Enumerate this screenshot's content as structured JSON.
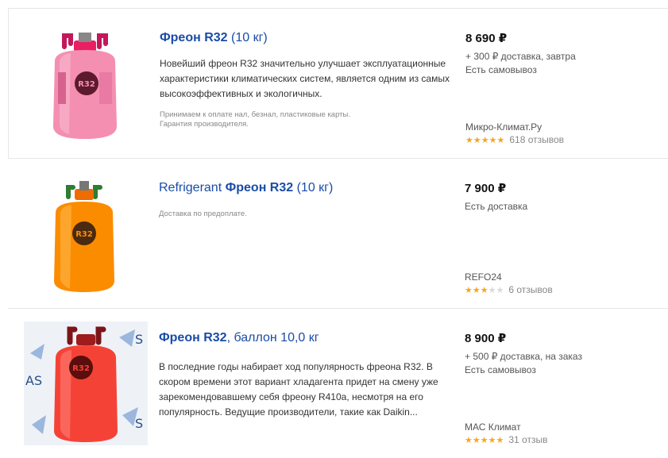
{
  "colors": {
    "link": "#1a4ca8",
    "star": "#f5a623"
  },
  "offers": [
    {
      "title_bold_1": "Фреон R32",
      "title_rest": " (10 кг)",
      "desc": "Новейший фреон R32 значительно улучшает эксплуатационные характеристики климатических систем, является одним из самых высокоэффективных и экологичных.",
      "note_1": "Принимаем к оплате нал, безнал, пластиковые карты.",
      "note_2": "Гарантия производителя.",
      "price": "8 690 ₽",
      "delivery": "+ 300 ₽ доставка, завтра",
      "pickup": "Есть самовывоз",
      "shop": "Микро-Климат.Ру",
      "stars": 5,
      "reviews": "618 отзывов",
      "image_label": "R32",
      "image_color": "pink"
    },
    {
      "title_prefix": "Refrigerant ",
      "title_bold_1": "Фреон R32",
      "title_rest": " (10 кг)",
      "note_1": "Доставка по предоплате.",
      "price": "7 900 ₽",
      "delivery": "Есть доставка",
      "shop": "REFO24",
      "stars": 3,
      "reviews": "6 отзывов",
      "image_label": "R32",
      "image_color": "orange"
    },
    {
      "title_bold_1": "Фреон R32",
      "title_rest": ", баллон 10,0 кг",
      "desc": "В последние годы набирает ход популярность фреона R32. В скором времени этот вариант хладагента придет на смену уже зарекомендовавшему себя фреону R410a, несмотря на его популярность. Ведущие производители, такие как Daikin...",
      "price": "8 900 ₽",
      "delivery": "+ 500 ₽ доставка, на заказ",
      "pickup": "Есть самовывоз",
      "shop": "МАС Климат",
      "stars": 5,
      "reviews": "31 отзыв",
      "image_label": "R32",
      "image_color": "red",
      "watermark_text": "AS"
    }
  ]
}
